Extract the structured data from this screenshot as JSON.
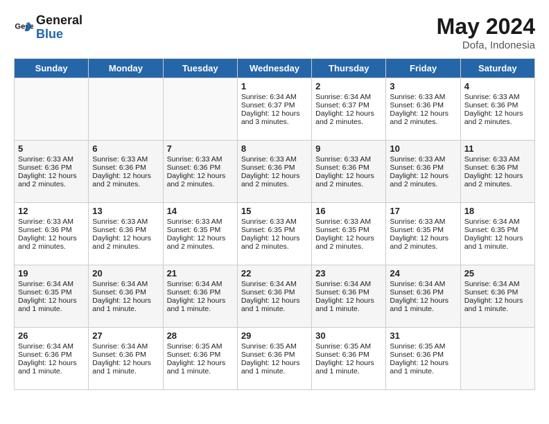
{
  "header": {
    "logo_general": "General",
    "logo_blue": "Blue",
    "month": "May 2024",
    "location": "Dofa, Indonesia"
  },
  "days_of_week": [
    "Sunday",
    "Monday",
    "Tuesday",
    "Wednesday",
    "Thursday",
    "Friday",
    "Saturday"
  ],
  "weeks": [
    [
      {
        "day": "",
        "info": ""
      },
      {
        "day": "",
        "info": ""
      },
      {
        "day": "",
        "info": ""
      },
      {
        "day": "1",
        "info": "Sunrise: 6:34 AM\nSunset: 6:37 PM\nDaylight: 12 hours\nand 3 minutes."
      },
      {
        "day": "2",
        "info": "Sunrise: 6:34 AM\nSunset: 6:37 PM\nDaylight: 12 hours\nand 2 minutes."
      },
      {
        "day": "3",
        "info": "Sunrise: 6:33 AM\nSunset: 6:36 PM\nDaylight: 12 hours\nand 2 minutes."
      },
      {
        "day": "4",
        "info": "Sunrise: 6:33 AM\nSunset: 6:36 PM\nDaylight: 12 hours\nand 2 minutes."
      }
    ],
    [
      {
        "day": "5",
        "info": "Sunrise: 6:33 AM\nSunset: 6:36 PM\nDaylight: 12 hours\nand 2 minutes."
      },
      {
        "day": "6",
        "info": "Sunrise: 6:33 AM\nSunset: 6:36 PM\nDaylight: 12 hours\nand 2 minutes."
      },
      {
        "day": "7",
        "info": "Sunrise: 6:33 AM\nSunset: 6:36 PM\nDaylight: 12 hours\nand 2 minutes."
      },
      {
        "day": "8",
        "info": "Sunrise: 6:33 AM\nSunset: 6:36 PM\nDaylight: 12 hours\nand 2 minutes."
      },
      {
        "day": "9",
        "info": "Sunrise: 6:33 AM\nSunset: 6:36 PM\nDaylight: 12 hours\nand 2 minutes."
      },
      {
        "day": "10",
        "info": "Sunrise: 6:33 AM\nSunset: 6:36 PM\nDaylight: 12 hours\nand 2 minutes."
      },
      {
        "day": "11",
        "info": "Sunrise: 6:33 AM\nSunset: 6:36 PM\nDaylight: 12 hours\nand 2 minutes."
      }
    ],
    [
      {
        "day": "12",
        "info": "Sunrise: 6:33 AM\nSunset: 6:36 PM\nDaylight: 12 hours\nand 2 minutes."
      },
      {
        "day": "13",
        "info": "Sunrise: 6:33 AM\nSunset: 6:36 PM\nDaylight: 12 hours\nand 2 minutes."
      },
      {
        "day": "14",
        "info": "Sunrise: 6:33 AM\nSunset: 6:35 PM\nDaylight: 12 hours\nand 2 minutes."
      },
      {
        "day": "15",
        "info": "Sunrise: 6:33 AM\nSunset: 6:35 PM\nDaylight: 12 hours\nand 2 minutes."
      },
      {
        "day": "16",
        "info": "Sunrise: 6:33 AM\nSunset: 6:35 PM\nDaylight: 12 hours\nand 2 minutes."
      },
      {
        "day": "17",
        "info": "Sunrise: 6:33 AM\nSunset: 6:35 PM\nDaylight: 12 hours\nand 2 minutes."
      },
      {
        "day": "18",
        "info": "Sunrise: 6:34 AM\nSunset: 6:35 PM\nDaylight: 12 hours\nand 1 minute."
      }
    ],
    [
      {
        "day": "19",
        "info": "Sunrise: 6:34 AM\nSunset: 6:35 PM\nDaylight: 12 hours\nand 1 minute."
      },
      {
        "day": "20",
        "info": "Sunrise: 6:34 AM\nSunset: 6:36 PM\nDaylight: 12 hours\nand 1 minute."
      },
      {
        "day": "21",
        "info": "Sunrise: 6:34 AM\nSunset: 6:36 PM\nDaylight: 12 hours\nand 1 minute."
      },
      {
        "day": "22",
        "info": "Sunrise: 6:34 AM\nSunset: 6:36 PM\nDaylight: 12 hours\nand 1 minute."
      },
      {
        "day": "23",
        "info": "Sunrise: 6:34 AM\nSunset: 6:36 PM\nDaylight: 12 hours\nand 1 minute."
      },
      {
        "day": "24",
        "info": "Sunrise: 6:34 AM\nSunset: 6:36 PM\nDaylight: 12 hours\nand 1 minute."
      },
      {
        "day": "25",
        "info": "Sunrise: 6:34 AM\nSunset: 6:36 PM\nDaylight: 12 hours\nand 1 minute."
      }
    ],
    [
      {
        "day": "26",
        "info": "Sunrise: 6:34 AM\nSunset: 6:36 PM\nDaylight: 12 hours\nand 1 minute."
      },
      {
        "day": "27",
        "info": "Sunrise: 6:34 AM\nSunset: 6:36 PM\nDaylight: 12 hours\nand 1 minute."
      },
      {
        "day": "28",
        "info": "Sunrise: 6:35 AM\nSunset: 6:36 PM\nDaylight: 12 hours\nand 1 minute."
      },
      {
        "day": "29",
        "info": "Sunrise: 6:35 AM\nSunset: 6:36 PM\nDaylight: 12 hours\nand 1 minute."
      },
      {
        "day": "30",
        "info": "Sunrise: 6:35 AM\nSunset: 6:36 PM\nDaylight: 12 hours\nand 1 minute."
      },
      {
        "day": "31",
        "info": "Sunrise: 6:35 AM\nSunset: 6:36 PM\nDaylight: 12 hours\nand 1 minute."
      },
      {
        "day": "",
        "info": ""
      }
    ]
  ]
}
